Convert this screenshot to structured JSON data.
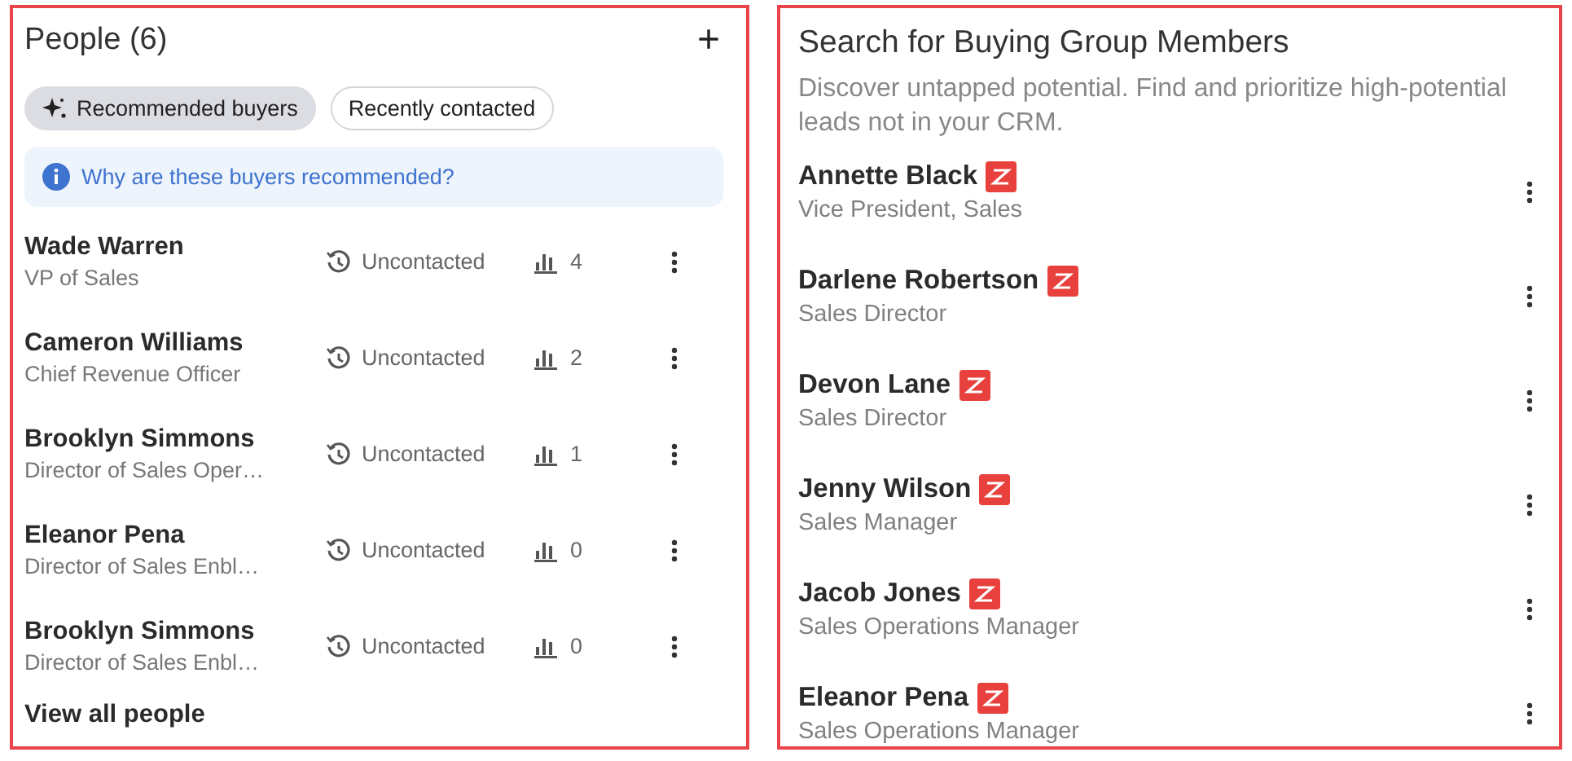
{
  "people_panel": {
    "title": "People (6)",
    "add_button": "+",
    "tabs": [
      {
        "label": "Recommended buyers",
        "selected": true
      },
      {
        "label": "Recently contacted",
        "selected": false
      }
    ],
    "info_link": "Why are these buyers recommended?",
    "people": [
      {
        "name": "Wade Warren",
        "title": "VP of Sales",
        "status": "Uncontacted",
        "score": "4"
      },
      {
        "name": "Cameron Williams",
        "title": "Chief Revenue Officer",
        "status": "Uncontacted",
        "score": "2"
      },
      {
        "name": "Brooklyn Simmons",
        "title": "Director of Sales Oper…",
        "status": "Uncontacted",
        "score": "1"
      },
      {
        "name": "Eleanor Pena",
        "title": "Director of Sales Enbl…",
        "status": "Uncontacted",
        "score": "0"
      },
      {
        "name": "Brooklyn Simmons",
        "title": "Director of Sales Enbl…",
        "status": "Uncontacted",
        "score": "0"
      }
    ],
    "view_all": "View all people"
  },
  "search_panel": {
    "title": "Search for Buying Group Members",
    "description": "Discover untapped potential. Find and prioritize high-potential leads not in your CRM.",
    "members": [
      {
        "name": "Annette Black",
        "title": "Vice President, Sales"
      },
      {
        "name": "Darlene Robertson",
        "title": "Sales Director"
      },
      {
        "name": "Devon Lane",
        "title": "Sales Director"
      },
      {
        "name": "Jenny Wilson",
        "title": "Sales Manager"
      },
      {
        "name": "Jacob Jones",
        "title": "Sales Operations Manager"
      },
      {
        "name": "Eleanor Pena",
        "title": "Sales Operations Manager"
      }
    ]
  }
}
